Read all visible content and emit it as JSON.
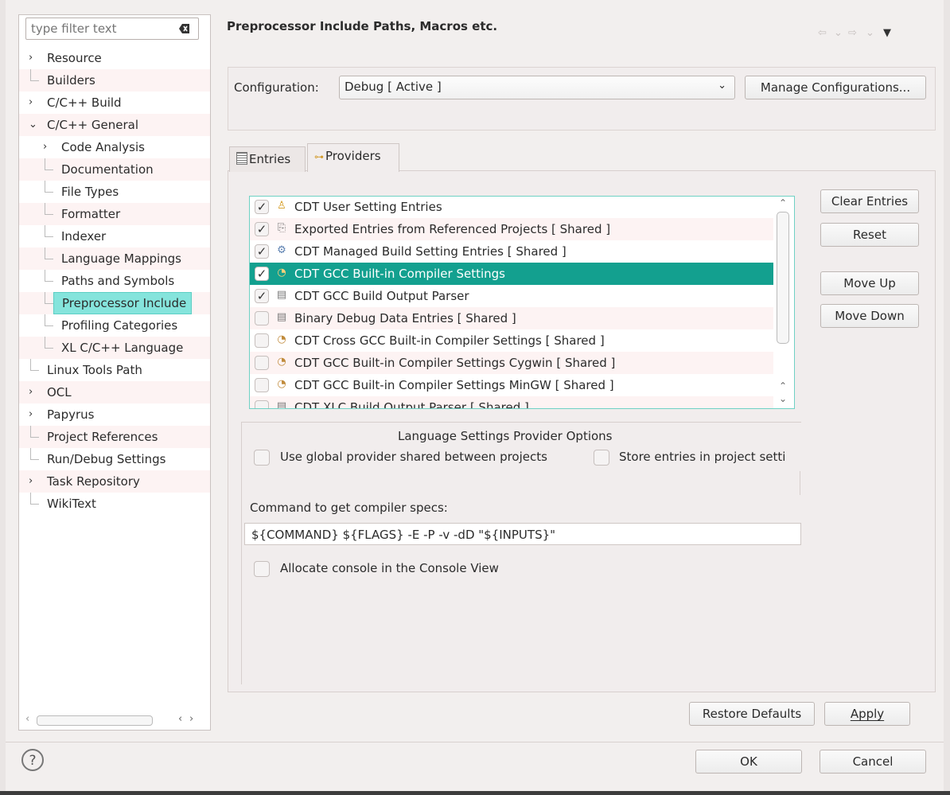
{
  "filter": {
    "placeholder": "type filter text"
  },
  "tree": {
    "items": [
      {
        "label": "Resource",
        "level": 0,
        "expander": "›"
      },
      {
        "label": "Builders",
        "level": 0,
        "expander": ""
      },
      {
        "label": "C/C++ Build",
        "level": 0,
        "expander": "›"
      },
      {
        "label": "C/C++ General",
        "level": 0,
        "expander": "⌄"
      },
      {
        "label": "Code Analysis",
        "level": 1,
        "expander": "›"
      },
      {
        "label": "Documentation",
        "level": 1,
        "expander": ""
      },
      {
        "label": "File Types",
        "level": 1,
        "expander": ""
      },
      {
        "label": "Formatter",
        "level": 1,
        "expander": ""
      },
      {
        "label": "Indexer",
        "level": 1,
        "expander": ""
      },
      {
        "label": "Language Mappings",
        "level": 1,
        "expander": ""
      },
      {
        "label": "Paths and Symbols",
        "level": 1,
        "expander": ""
      },
      {
        "label": "Preprocessor Include",
        "level": 1,
        "expander": "",
        "selected": true
      },
      {
        "label": "Profiling Categories",
        "level": 1,
        "expander": ""
      },
      {
        "label": "XL C/C++ Language",
        "level": 1,
        "expander": ""
      },
      {
        "label": "Linux Tools Path",
        "level": 0,
        "expander": ""
      },
      {
        "label": "OCL",
        "level": 0,
        "expander": "›"
      },
      {
        "label": "Papyrus",
        "level": 0,
        "expander": "›"
      },
      {
        "label": "Project References",
        "level": 0,
        "expander": ""
      },
      {
        "label": "Run/Debug Settings",
        "level": 0,
        "expander": ""
      },
      {
        "label": "Task Repository",
        "level": 0,
        "expander": "›"
      },
      {
        "label": "WikiText",
        "level": 0,
        "expander": ""
      }
    ]
  },
  "header": {
    "title": "Preprocessor Include Paths, Macros etc."
  },
  "config": {
    "label": "Configuration:",
    "value": "Debug  [ Active ]",
    "manage_label": "Manage Configurations..."
  },
  "tabs": {
    "entries": "Entries",
    "providers": "Providers"
  },
  "providers": [
    {
      "label": "CDT User Setting Entries",
      "checked": true,
      "icon": "user-icon"
    },
    {
      "label": "Exported Entries from Referenced Projects   [ Shared ]",
      "checked": true,
      "icon": "export-icon"
    },
    {
      "label": "CDT Managed Build Setting Entries   [ Shared ]",
      "checked": true,
      "icon": "managed-build-icon"
    },
    {
      "label": "CDT GCC Built-in Compiler Settings",
      "checked": true,
      "icon": "compiler-icon",
      "selected": true
    },
    {
      "label": "CDT GCC Build Output Parser",
      "checked": true,
      "icon": "parser-icon"
    },
    {
      "label": "Binary Debug Data Entries   [ Shared ]",
      "checked": false,
      "icon": "parser-icon"
    },
    {
      "label": "CDT Cross GCC Built-in Compiler Settings   [ Shared ]",
      "checked": false,
      "icon": "compiler-icon"
    },
    {
      "label": "CDT GCC Built-in Compiler Settings Cygwin   [ Shared ]",
      "checked": false,
      "icon": "compiler-icon"
    },
    {
      "label": "CDT GCC Built-in Compiler Settings MinGW   [ Shared ]",
      "checked": false,
      "icon": "compiler-icon"
    },
    {
      "label": "CDT XLC Build Output Parser   [ Shared ]",
      "checked": false,
      "icon": "parser-icon"
    }
  ],
  "side_buttons": {
    "clear": "Clear Entries",
    "reset": "Reset",
    "move_up": "Move Up",
    "move_down": "Move Down"
  },
  "options": {
    "title": "Language Settings Provider Options",
    "use_global": "Use global provider shared between projects",
    "store_entries": "Store entries in project setti",
    "command_label": "Command to get compiler specs:",
    "command_value": "${COMMAND} ${FLAGS} -E -P -v -dD \"${INPUTS}\"",
    "allocate_console": "Allocate console in the Console View"
  },
  "actions": {
    "restore_defaults": "Restore Defaults",
    "apply": "Apply"
  },
  "dialog": {
    "ok": "OK",
    "cancel": "Cancel"
  },
  "colors": {
    "selection": "#13a08f",
    "tree_selection": "#85e4dc",
    "list_border": "#6fd1c4"
  }
}
